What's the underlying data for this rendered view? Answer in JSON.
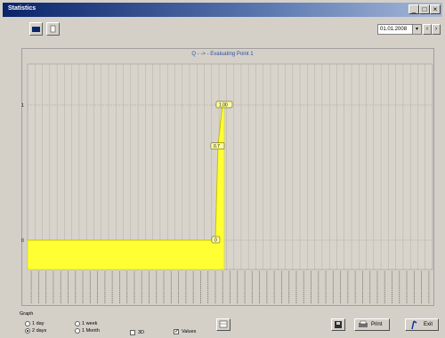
{
  "window": {
    "title": "Statistics"
  },
  "titlebar_buttons": {
    "min": "_",
    "max": "□",
    "close": "×"
  },
  "combo": {
    "value": "01.01.2008"
  },
  "chart_data": {
    "type": "area",
    "title": "Q - -> - Evaluating Point 1",
    "ylabels": [
      "1",
      "0"
    ],
    "fill_color": "#ffff33",
    "x_count": 55,
    "step_index": 25,
    "values_before": 0,
    "values_after_peak": [
      0,
      0.7,
      1.0
    ],
    "annotations": [
      "0",
      "0.7",
      "1.00"
    ]
  },
  "bottom": {
    "group_label": "Graph",
    "radios": [
      {
        "label": "1 day",
        "checked": false
      },
      {
        "label": "2 days",
        "checked": true
      },
      {
        "label": "1 week",
        "checked": false
      },
      {
        "label": "1 Month",
        "checked": false
      }
    ],
    "checkbox_3d": {
      "label": "3D",
      "checked": false
    },
    "checkbox_values": {
      "label": "Values",
      "checked": true
    },
    "print_label": "Print",
    "exit_label": "Exit"
  }
}
